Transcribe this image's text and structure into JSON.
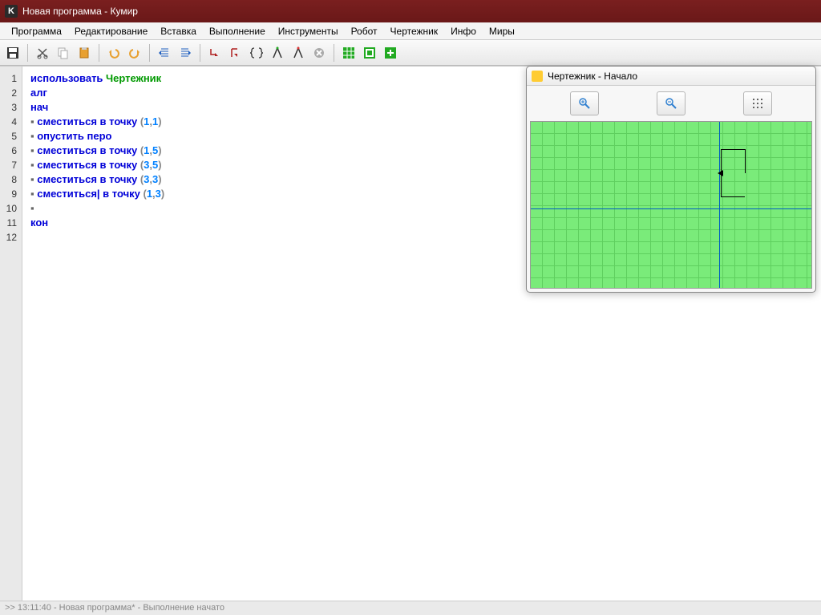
{
  "window": {
    "title": "Новая программа - Кумир"
  },
  "menu": {
    "items": [
      "Программа",
      "Редактирование",
      "Вставка",
      "Выполнение",
      "Инструменты",
      "Робот",
      "Чертежник",
      "Инфо",
      "Миры"
    ]
  },
  "code": {
    "lines": [
      {
        "n": "1",
        "t": [
          [
            "kw-blue",
            "использовать "
          ],
          [
            "kw-green",
            "Чертежник"
          ]
        ]
      },
      {
        "n": "2",
        "t": [
          [
            "kw-blue",
            "алг"
          ]
        ]
      },
      {
        "n": "3",
        "t": [
          [
            "kw-blue",
            "нач"
          ]
        ]
      },
      {
        "n": "4",
        "t": [
          [
            "bullet",
            "▪ "
          ],
          [
            "kw-blue",
            "сместиться в точку "
          ],
          [
            "punct",
            "("
          ],
          [
            "num",
            "1"
          ],
          [
            "punct",
            ","
          ],
          [
            "num",
            "1"
          ],
          [
            "punct",
            ")"
          ]
        ]
      },
      {
        "n": "5",
        "t": [
          [
            "bullet",
            "▪ "
          ],
          [
            "kw-blue",
            "опустить перо"
          ]
        ]
      },
      {
        "n": "6",
        "t": [
          [
            "bullet",
            "▪ "
          ],
          [
            "kw-blue",
            "сместиться в точку "
          ],
          [
            "punct",
            "("
          ],
          [
            "num",
            "1"
          ],
          [
            "punct",
            ","
          ],
          [
            "num",
            "5"
          ],
          [
            "punct",
            ")"
          ]
        ]
      },
      {
        "n": "7",
        "t": [
          [
            "bullet",
            "▪ "
          ],
          [
            "kw-blue",
            "сместиться в точку "
          ],
          [
            "punct",
            "("
          ],
          [
            "num",
            "3"
          ],
          [
            "punct",
            ","
          ],
          [
            "num",
            "5"
          ],
          [
            "punct",
            ")"
          ]
        ]
      },
      {
        "n": "8",
        "t": [
          [
            "bullet",
            "▪ "
          ],
          [
            "kw-blue",
            "сместиться в точку "
          ],
          [
            "punct",
            "("
          ],
          [
            "num",
            "3"
          ],
          [
            "punct",
            ","
          ],
          [
            "num",
            "3"
          ],
          [
            "punct",
            ")"
          ]
        ]
      },
      {
        "n": "9",
        "t": [
          [
            "bullet",
            "▪ "
          ],
          [
            "kw-blue",
            "сместиться| в точку "
          ],
          [
            "punct",
            "("
          ],
          [
            "num",
            "1"
          ],
          [
            "punct",
            ","
          ],
          [
            "num",
            "3"
          ],
          [
            "punct",
            ")"
          ]
        ]
      },
      {
        "n": "10",
        "t": [
          [
            "bullet",
            "▪"
          ]
        ]
      },
      {
        "n": "11",
        "t": [
          [
            "kw-blue",
            "кон"
          ]
        ]
      },
      {
        "n": "12",
        "t": []
      }
    ]
  },
  "drawer": {
    "title": "Чертежник - Начало"
  },
  "status": {
    "text": ">> 13:11:40 - Новая программа* - Выполнение начато"
  }
}
